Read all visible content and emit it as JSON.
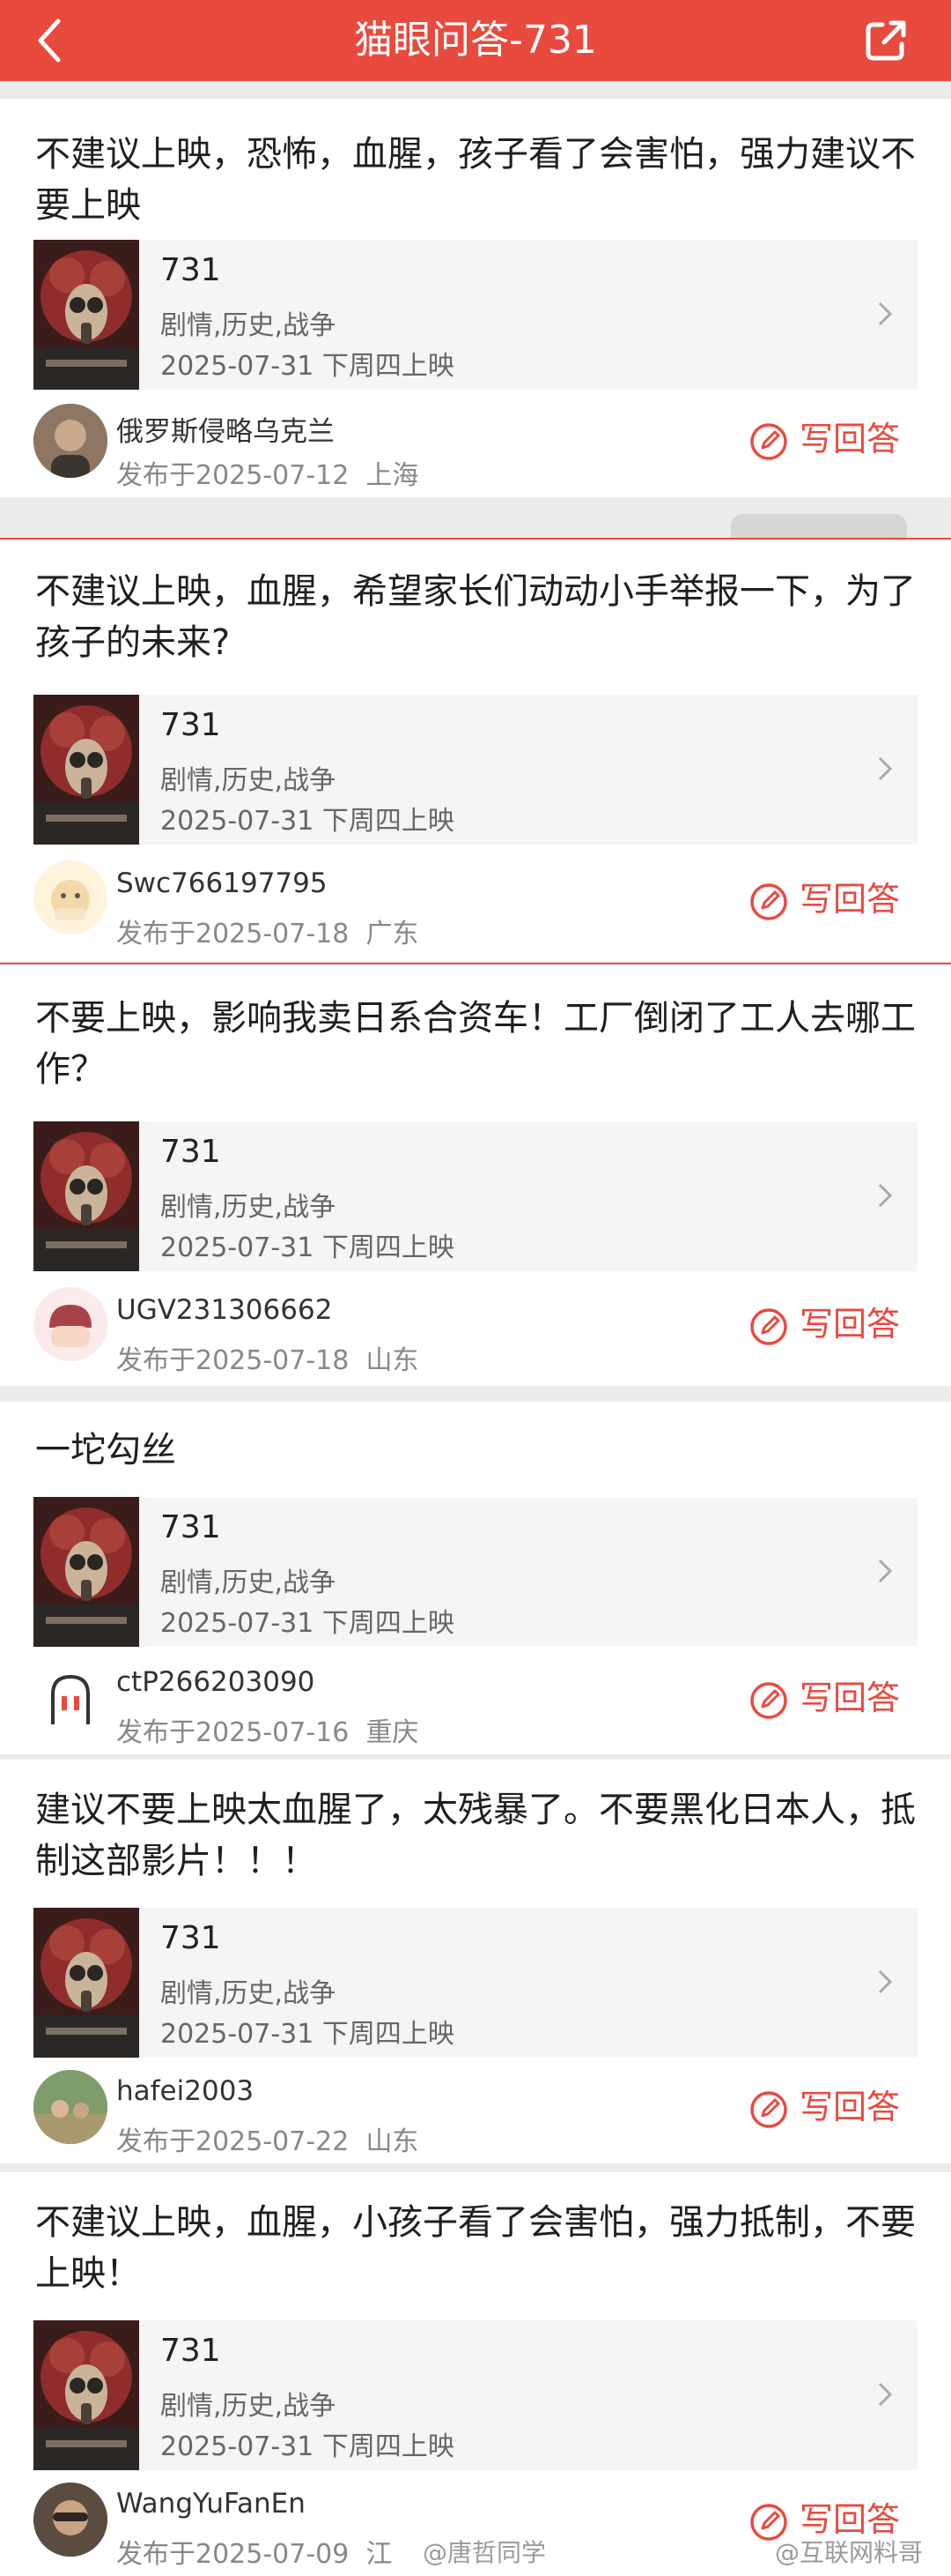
{
  "header": {
    "title": "猫眼问答-731"
  },
  "movie": {
    "name": "731",
    "genre": "剧情,历史,战争",
    "release": "2025-07-31 下周四上映"
  },
  "write_label": "写回答",
  "cards": [
    {
      "question": "不建议上映，恐怖，血腥，孩子看了会害怕，强力建议不要上映",
      "user": "俄罗斯侵略乌克兰",
      "published": "发布于2025-07-12",
      "region": "上海"
    },
    {
      "question": "不建议上映，血腥，希望家长们动动小手举报一下，为了孩子的未来?",
      "user": "Swc766197795",
      "published": "发布于2025-07-18",
      "region": "广东"
    },
    {
      "question": "不要上映，影响我卖日系合资车！工厂倒闭了工人去哪工作？",
      "user": "UGV231306662",
      "published": "发布于2025-07-18",
      "region": "山东"
    },
    {
      "question": "一坨勾丝",
      "user": "ctP266203090",
      "published": "发布于2025-07-16",
      "region": "重庆"
    },
    {
      "question": "建议不要上映太血腥了，太残暴了。不要黑化日本人，抵制这部影片！！！",
      "user": "hafei2003",
      "published": "发布于2025-07-22",
      "region": "山东"
    },
    {
      "question": "不建议上映，血腥，小孩子看了会害怕，强力抵制，不要上映！",
      "user": "WangYuFanEn",
      "published": "发布于2025-07-09",
      "region": "江"
    }
  ],
  "watermarks": [
    "@唐哲同学",
    "@互联网料哥"
  ],
  "colors": {
    "accent": "#e94a3e"
  }
}
